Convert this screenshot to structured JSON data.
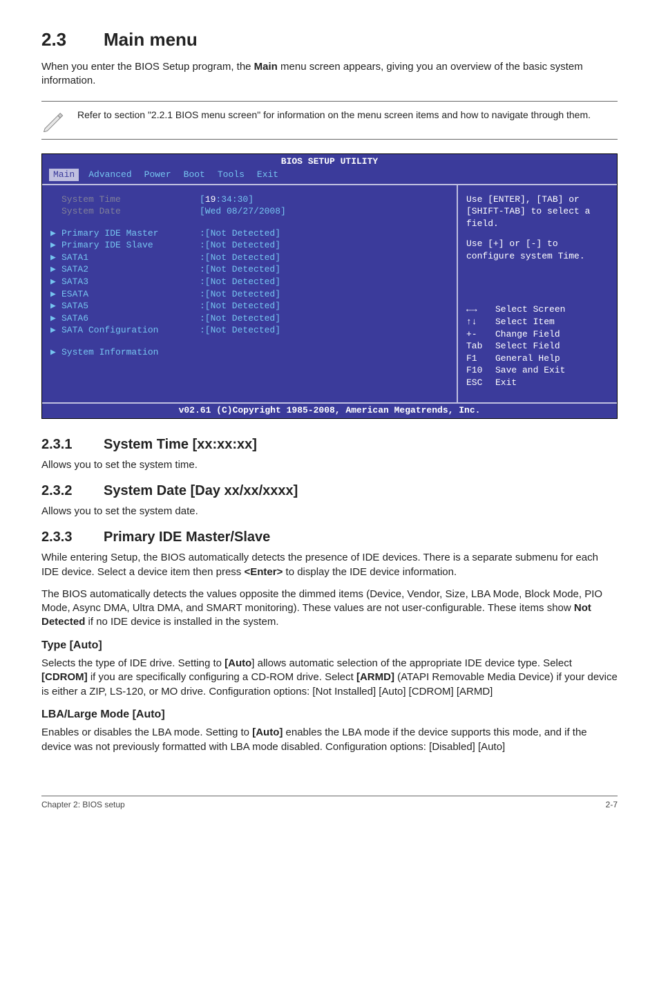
{
  "section": {
    "number": "2.3",
    "title": "Main menu"
  },
  "intro": "When you enter the BIOS Setup program, the Main menu screen appears, giving you an overview of the basic system information.",
  "intro_bold": "Main",
  "note": "Refer to section \"2.2.1 BIOS menu screen\" for information on the menu screen items and how to navigate through them.",
  "bios": {
    "title": "BIOS SETUP UTILITY",
    "menus": [
      "Main",
      "Advanced",
      "Power",
      "Boot",
      "Tools",
      "Exit"
    ],
    "active_menu": "Main",
    "fields": {
      "system_time_label": "System Time",
      "system_time_value_pre": "[",
      "system_time_value_hl": "19",
      "system_time_value_post": ":34:30]",
      "system_date_label": "System Date",
      "system_date_value": "[Wed 08/27/2008]"
    },
    "items": [
      {
        "label": "Primary IDE Master",
        "value": ":[Not Detected]"
      },
      {
        "label": "Primary IDE Slave",
        "value": ":[Not Detected]"
      },
      {
        "label": "SATA1",
        "value": ":[Not Detected]"
      },
      {
        "label": "SATA2",
        "value": ":[Not Detected]"
      },
      {
        "label": "SATA3",
        "value": ":[Not Detected]"
      },
      {
        "label": "ESATA",
        "value": ":[Not Detected]"
      },
      {
        "label": "SATA5",
        "value": ":[Not Detected]"
      },
      {
        "label": "SATA6",
        "value": ":[Not Detected]"
      },
      {
        "label": "SATA Configuration",
        "value": ":[Not Detected]"
      }
    ],
    "last_item": {
      "label": "System Information"
    },
    "help1": "Use [ENTER], [TAB] or [SHIFT-TAB] to select a field.",
    "help2": "Use [+] or [-] to configure system Time.",
    "keys": [
      {
        "k": "←→",
        "desc": "Select Screen"
      },
      {
        "k": "↑↓",
        "desc": "Select Item"
      },
      {
        "k": "+-",
        "desc": "Change Field"
      },
      {
        "k": "Tab",
        "desc": "Select Field"
      },
      {
        "k": "F1",
        "desc": "General Help"
      },
      {
        "k": "F10",
        "desc": "Save and Exit"
      },
      {
        "k": "ESC",
        "desc": "Exit"
      }
    ],
    "footer": "v02.61 (C)Copyright 1985-2008, American Megatrends, Inc."
  },
  "sub": {
    "s1": {
      "num": "2.3.1",
      "title": "System Time [xx:xx:xx]",
      "body": "Allows you to set the system time."
    },
    "s2": {
      "num": "2.3.2",
      "title": "System Date [Day xx/xx/xxxx]",
      "body": "Allows you to set the system date."
    },
    "s3": {
      "num": "2.3.3",
      "title": "Primary IDE Master/Slave",
      "p1a": "While entering Setup, the BIOS automatically detects the presence of IDE devices. There is a separate submenu for each IDE device. Select a device item then press ",
      "p1b": "<Enter>",
      "p1c": " to display the IDE device information.",
      "p2a": "The BIOS automatically detects the values opposite the dimmed items (Device, Vendor, Size, LBA Mode, Block Mode, PIO Mode, Async DMA, Ultra DMA, and SMART monitoring). These values are not user-configurable. These items show ",
      "p2b": "Not Detected",
      "p2c": " if no IDE device is installed in the system."
    },
    "type": {
      "title": "Type [Auto]",
      "p_a": "Selects the type of IDE drive. Setting to ",
      "p_b": "[Auto",
      "p_c": "] allows automatic selection of the appropriate IDE device type. Select ",
      "p_d": "[CDROM]",
      "p_e": " if you are specifically configuring a CD-ROM drive. Select ",
      "p_f": "[ARMD]",
      "p_g": " (ATAPI Removable Media Device) if your device is either a ZIP, LS-120, or MO drive. Configuration options: [Not Installed] [Auto] [CDROM] [ARMD]"
    },
    "lba": {
      "title": "LBA/Large Mode [Auto]",
      "p_a": "Enables or disables the LBA mode. Setting to ",
      "p_b": "[Auto]",
      "p_c": " enables the LBA mode if the device supports this mode, and if the device was not previously formatted with LBA mode disabled. Configuration options: [Disabled] [Auto]"
    }
  },
  "footer": {
    "left": "Chapter 2: BIOS setup",
    "right": "2-7"
  }
}
